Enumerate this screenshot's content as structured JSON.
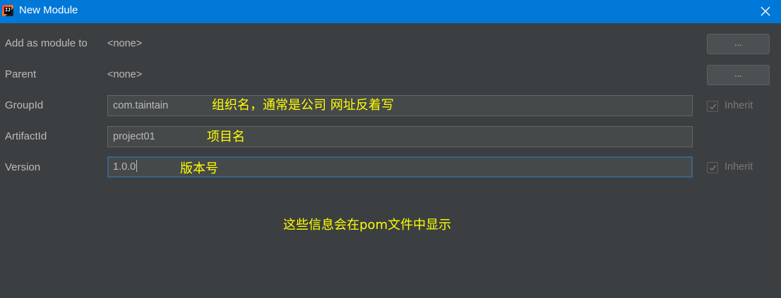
{
  "window": {
    "title": "New Module",
    "app_icon_text": "IJ"
  },
  "form": {
    "add_as_module_to": {
      "label": "Add as module to",
      "value": "<none>",
      "browse_label": "..."
    },
    "parent": {
      "label": "Parent",
      "value": "<none>",
      "browse_label": "..."
    },
    "group_id": {
      "label": "GroupId",
      "value": "com.taintain",
      "inherit_label": "Inherit",
      "inherit_checked": true
    },
    "artifact_id": {
      "label": "ArtifactId",
      "value": "project01"
    },
    "version": {
      "label": "Version",
      "value": "1.0.0",
      "inherit_label": "Inherit",
      "inherit_checked": true
    }
  },
  "annotations": {
    "group_id_note": "组织名，通常是公司 网址反着写",
    "artifact_id_note": "项目名",
    "version_note": "版本号",
    "footer_note": "这些信息会在pom文件中显示"
  },
  "colors": {
    "titlebar": "#0078d7",
    "background": "#3c3f41",
    "annotation": "#ffff00",
    "focus_border": "#3d6185"
  }
}
